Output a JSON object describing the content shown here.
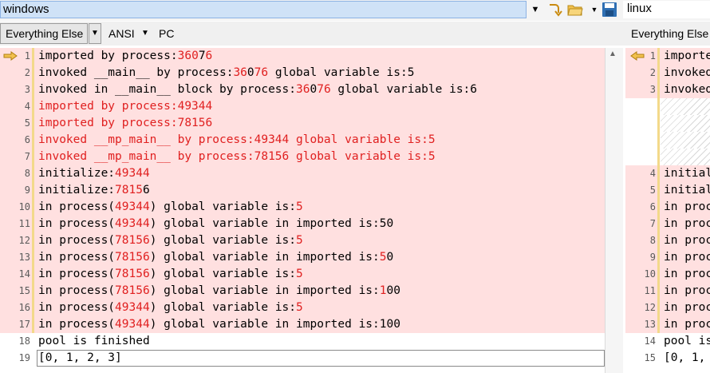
{
  "toolbar": {
    "left_path": "windows",
    "right_path": "linux"
  },
  "format_bar": {
    "left_format": "Everything Else",
    "encoding": "ANSI",
    "line_ending": "PC",
    "right_format": "Everything Else"
  },
  "left_pane": {
    "lines": [
      {
        "n": "1",
        "segs": [
          {
            "t": "imported by process:"
          },
          {
            "t": "360",
            "c": "red"
          },
          {
            "t": "7",
            "c": ""
          },
          {
            "t": "6",
            "c": "red"
          }
        ],
        "diff": true
      },
      {
        "n": "2",
        "segs": [
          {
            "t": "invoked __main__ by process:"
          },
          {
            "t": "36",
            "c": "red"
          },
          {
            "t": "0"
          },
          {
            "t": "76",
            "c": "red"
          },
          {
            "t": " global variable is:5"
          }
        ],
        "diff": true
      },
      {
        "n": "3",
        "segs": [
          {
            "t": "invoked in __main__ block by process:"
          },
          {
            "t": "36",
            "c": "red"
          },
          {
            "t": "0"
          },
          {
            "t": "76",
            "c": "red"
          },
          {
            "t": " global variable is:6"
          }
        ],
        "diff": true
      },
      {
        "n": "4",
        "segs": [
          {
            "t": "imported by process:49344",
            "c": "red"
          }
        ],
        "diff": true
      },
      {
        "n": "5",
        "segs": [
          {
            "t": "imported by process:78156",
            "c": "red"
          }
        ],
        "diff": true
      },
      {
        "n": "6",
        "segs": [
          {
            "t": "invoked __mp_main__ by process:49344 global variable is:5",
            "c": "red"
          }
        ],
        "diff": true
      },
      {
        "n": "7",
        "segs": [
          {
            "t": "invoked __mp_main__ by process:78156 global variable is:5",
            "c": "red"
          }
        ],
        "diff": true
      },
      {
        "n": "8",
        "segs": [
          {
            "t": "initialize:"
          },
          {
            "t": "49344",
            "c": "red"
          }
        ],
        "diff": true
      },
      {
        "n": "9",
        "segs": [
          {
            "t": "initialize:"
          },
          {
            "t": "7815",
            "c": "red"
          },
          {
            "t": "6"
          }
        ],
        "diff": true
      },
      {
        "n": "10",
        "segs": [
          {
            "t": "in process("
          },
          {
            "t": "49344",
            "c": "red"
          },
          {
            "t": ") global variable is:"
          },
          {
            "t": "5",
            "c": "red"
          }
        ],
        "diff": true
      },
      {
        "n": "11",
        "segs": [
          {
            "t": "in process("
          },
          {
            "t": "49344",
            "c": "red"
          },
          {
            "t": ") global variable in imported is:50"
          }
        ],
        "diff": true
      },
      {
        "n": "12",
        "segs": [
          {
            "t": "in process("
          },
          {
            "t": "78156",
            "c": "red"
          },
          {
            "t": ") global variable is:"
          },
          {
            "t": "5",
            "c": "red"
          }
        ],
        "diff": true
      },
      {
        "n": "13",
        "segs": [
          {
            "t": "in process("
          },
          {
            "t": "78156",
            "c": "red"
          },
          {
            "t": ") global variable in imported is:"
          },
          {
            "t": "5",
            "c": "red"
          },
          {
            "t": "0"
          }
        ],
        "diff": true
      },
      {
        "n": "14",
        "segs": [
          {
            "t": "in process("
          },
          {
            "t": "78156",
            "c": "red"
          },
          {
            "t": ") global variable is:"
          },
          {
            "t": "5",
            "c": "red"
          }
        ],
        "diff": true
      },
      {
        "n": "15",
        "segs": [
          {
            "t": "in process("
          },
          {
            "t": "78156",
            "c": "red"
          },
          {
            "t": ") global variable in imported is:"
          },
          {
            "t": "1",
            "c": "red"
          },
          {
            "t": "00"
          }
        ],
        "diff": true
      },
      {
        "n": "16",
        "segs": [
          {
            "t": "in process("
          },
          {
            "t": "49344",
            "c": "red"
          },
          {
            "t": ") global variable is:"
          },
          {
            "t": "5",
            "c": "red"
          }
        ],
        "diff": true
      },
      {
        "n": "17",
        "segs": [
          {
            "t": "in process("
          },
          {
            "t": "49344",
            "c": "red"
          },
          {
            "t": ") global variable in imported is:100"
          }
        ],
        "diff": true
      },
      {
        "n": "18",
        "segs": [
          {
            "t": "pool is finished"
          }
        ],
        "diff": false
      },
      {
        "n": "19",
        "segs": [
          {
            "t": "[0, 1, 2, 3]"
          }
        ],
        "diff": false
      }
    ]
  },
  "right_pane": {
    "lines": [
      {
        "n": "1",
        "text": "importe",
        "diff": true
      },
      {
        "n": "2",
        "text": "invoked",
        "diff": true
      },
      {
        "n": "3",
        "text": "invoked",
        "diff": true
      },
      {
        "n": "",
        "text": "",
        "diff": false,
        "hatch": true
      },
      {
        "n": "",
        "text": "",
        "diff": false,
        "hatch": true
      },
      {
        "n": "",
        "text": "",
        "diff": false,
        "hatch": true
      },
      {
        "n": "",
        "text": "",
        "diff": false,
        "hatch": true
      },
      {
        "n": "4",
        "text": "initial",
        "diff": true
      },
      {
        "n": "5",
        "text": "initial",
        "diff": true
      },
      {
        "n": "6",
        "text": "in proc",
        "diff": true
      },
      {
        "n": "7",
        "text": "in proc",
        "diff": true
      },
      {
        "n": "8",
        "text": "in proc",
        "diff": true
      },
      {
        "n": "9",
        "text": "in proc",
        "diff": true
      },
      {
        "n": "10",
        "text": "in proc",
        "diff": true
      },
      {
        "n": "11",
        "text": "in proc",
        "diff": true
      },
      {
        "n": "12",
        "text": "in proc",
        "diff": true
      },
      {
        "n": "13",
        "text": "in proc",
        "diff": true
      },
      {
        "n": "14",
        "text": "pool is",
        "diff": false
      },
      {
        "n": "15",
        "text": "[0, 1,",
        "diff": false
      }
    ]
  },
  "colors": {
    "diff_bg": "#ffe0e0",
    "diff_text": "#e02020",
    "selected_path_bg": "#cfe2f7"
  }
}
